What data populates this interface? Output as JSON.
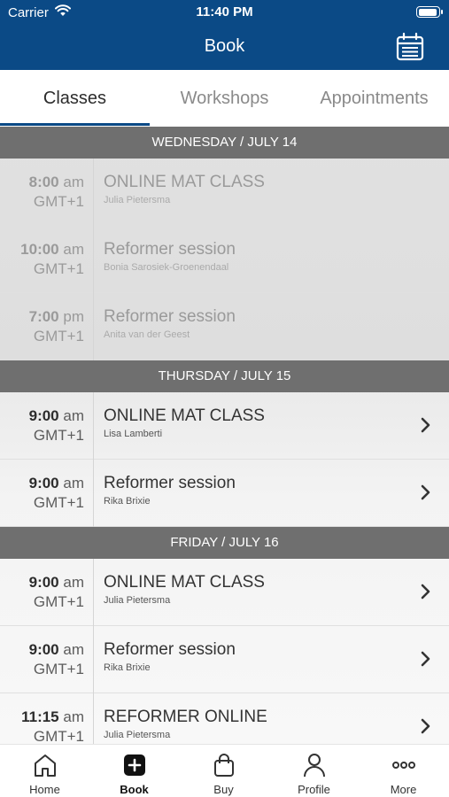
{
  "status_bar": {
    "carrier": "Carrier",
    "time": "11:40 PM"
  },
  "nav": {
    "title": "Book",
    "calendar_icon": "calendar-icon"
  },
  "tabs": [
    {
      "label": "Classes",
      "active": true
    },
    {
      "label": "Workshops",
      "active": false
    },
    {
      "label": "Appointments",
      "active": false
    }
  ],
  "days": [
    {
      "header": "WEDNESDAY / JULY 14",
      "sessions": [
        {
          "time": "8:00",
          "ampm": "am",
          "tz": "GMT+1",
          "name": "ONLINE MAT CLASS",
          "teacher": "Julia Pietersma"
        },
        {
          "time": "10:00",
          "ampm": "am",
          "tz": "GMT+1",
          "name": "Reformer session",
          "teacher": "Bonia Sarosiek-Groenendaal"
        },
        {
          "time": "7:00",
          "ampm": "pm",
          "tz": "GMT+1",
          "name": "Reformer session",
          "teacher": "Anita van der Geest"
        }
      ]
    },
    {
      "header": "THURSDAY / JULY 15",
      "sessions": [
        {
          "time": "9:00",
          "ampm": "am",
          "tz": "GMT+1",
          "name": "ONLINE MAT CLASS",
          "teacher": "Lisa Lamberti"
        },
        {
          "time": "9:00",
          "ampm": "am",
          "tz": "GMT+1",
          "name": "Reformer session",
          "teacher": "Rika Brixie"
        }
      ]
    },
    {
      "header": "FRIDAY / JULY 16",
      "sessions": [
        {
          "time": "9:00",
          "ampm": "am",
          "tz": "GMT+1",
          "name": "ONLINE MAT CLASS",
          "teacher": "Julia Pietersma"
        },
        {
          "time": "9:00",
          "ampm": "am",
          "tz": "GMT+1",
          "name": "Reformer session",
          "teacher": "Rika Brixie"
        },
        {
          "time": "11:15",
          "ampm": "am",
          "tz": "GMT+1",
          "name": "REFORMER ONLINE",
          "teacher": "Julia Pietersma"
        }
      ]
    }
  ],
  "bottom_tabs": [
    {
      "label": "Home",
      "icon": "home-icon"
    },
    {
      "label": "Book",
      "icon": "plus-square-icon",
      "active": true
    },
    {
      "label": "Buy",
      "icon": "shopping-bag-icon"
    },
    {
      "label": "Profile",
      "icon": "person-icon"
    },
    {
      "label": "More",
      "icon": "more-dots-icon"
    }
  ],
  "colors": {
    "brand": "#0b4a86",
    "day_header": "#6f6f6f"
  }
}
